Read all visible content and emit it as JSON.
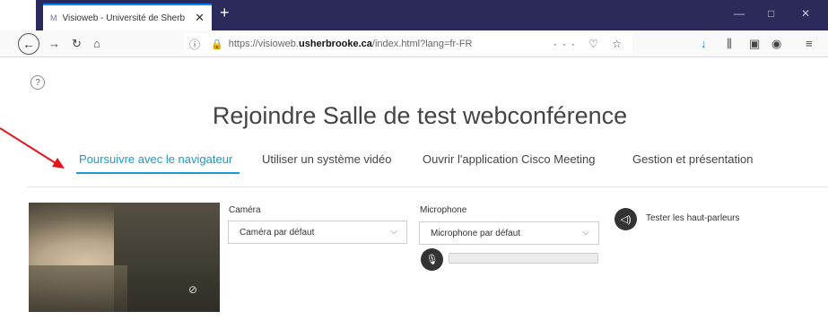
{
  "browser": {
    "tab_favicon": "M",
    "tab_title": "Visioweb - Université de Sherb",
    "tab_close": "✕",
    "new_tab": "+",
    "url_prefix": "https://visioweb.",
    "url_domain": "usherbrooke.ca",
    "url_suffix": "/index.html?lang=fr-FR",
    "url_actions": "··· ♡ ☆",
    "window_minimize": "—",
    "window_maximize": "□",
    "window_close": "✕"
  },
  "page": {
    "title": "Rejoindre Salle de test webconférence",
    "tabs": [
      {
        "label": "Poursuivre avec le navigateur",
        "active": true
      },
      {
        "label": "Utiliser un système vidéo",
        "active": false
      },
      {
        "label": "Ouvrir l'application Cisco Meeting",
        "active": false
      },
      {
        "label": "Gestion et présentation",
        "active": false
      }
    ],
    "camera": {
      "label": "Caméra",
      "selected": "Caméra par défaut"
    },
    "microphone": {
      "label": "Microphone",
      "selected": "Microphone par défaut",
      "level": 0
    },
    "speaker": {
      "label": "Tester les haut-parleurs"
    }
  },
  "annotation": {
    "arrow_color": "#e3151a"
  },
  "colors": {
    "accent": "#1a9ad6",
    "titlebar": "#2b2a5a",
    "secure": "#12bc00"
  }
}
